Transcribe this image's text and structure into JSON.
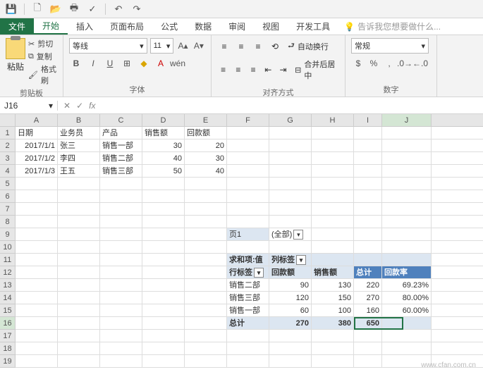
{
  "qat": {
    "save": "💾",
    "new": "🗋",
    "open": "📂",
    "print": "🖶",
    "spell": "✓",
    "undo": "↶",
    "redo": "↷"
  },
  "tabs": {
    "file": "文件",
    "home": "开始",
    "insert": "插入",
    "layout": "页面布局",
    "formula": "公式",
    "data": "数据",
    "review": "审阅",
    "view": "视图",
    "dev": "开发工具",
    "tell": "告诉我您想要做什么..."
  },
  "ribbon": {
    "clip": {
      "label": "剪贴板",
      "paste": "粘贴",
      "cut": "剪切",
      "copy": "复制",
      "painter": "格式刷"
    },
    "font": {
      "label": "字体",
      "name": "等线",
      "size": "11",
      "b": "B",
      "i": "I",
      "u": "U",
      "wen": "wén"
    },
    "align": {
      "label": "对齐方式",
      "wrap": "自动换行",
      "merge": "合并后居中"
    },
    "num": {
      "label": "数字",
      "general": "常规",
      "pct": "%",
      "comma": ","
    }
  },
  "namebox": "J16",
  "headers": {
    "A": "日期",
    "B": "业务员",
    "C": "产品",
    "D": "销售额",
    "E": "回款额"
  },
  "rows": [
    {
      "A": "2017/1/1",
      "B": "张三",
      "C": "销售一部",
      "D": "30",
      "E": "20"
    },
    {
      "A": "2017/1/2",
      "B": "李四",
      "C": "销售二部",
      "D": "40",
      "E": "30"
    },
    {
      "A": "2017/1/3",
      "B": "王五",
      "C": "销售三部",
      "D": "50",
      "E": "40"
    }
  ],
  "pivot": {
    "page_field": "页1",
    "page_val": "(全部)",
    "val_field": "求和项:值",
    "col_label": "列标签",
    "row_label": "行标签",
    "c1": "回款额",
    "c2": "销售额",
    "c3": "总计",
    "c4": "回款率",
    "r": [
      {
        "n": "销售二部",
        "v1": "90",
        "v2": "130",
        "v3": "220",
        "v4": "69.23%"
      },
      {
        "n": "销售三部",
        "v1": "120",
        "v2": "150",
        "v3": "270",
        "v4": "80.00%"
      },
      {
        "n": "销售一部",
        "v1": "60",
        "v2": "100",
        "v3": "160",
        "v4": "60.00%"
      }
    ],
    "tot": {
      "n": "总计",
      "v1": "270",
      "v2": "380",
      "v3": "650",
      "v4": ""
    }
  },
  "cols": [
    "A",
    "B",
    "C",
    "D",
    "E",
    "F",
    "G",
    "H",
    "I",
    "J"
  ],
  "watermark": "www.cfan.com.cn"
}
